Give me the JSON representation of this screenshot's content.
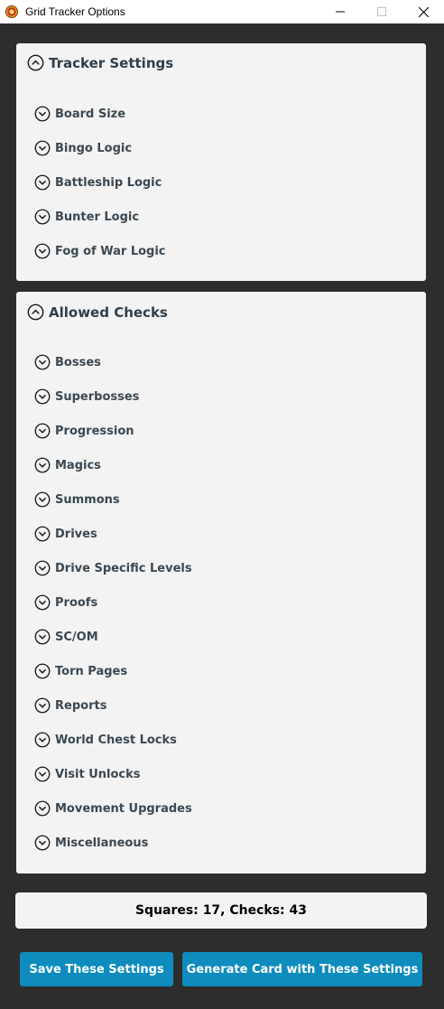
{
  "window": {
    "title": "Grid Tracker Options"
  },
  "tracker_settings": {
    "title": "Tracker Settings",
    "items": [
      {
        "label": "Board Size"
      },
      {
        "label": "Bingo Logic"
      },
      {
        "label": "Battleship Logic"
      },
      {
        "label": "Bunter Logic"
      },
      {
        "label": "Fog of War Logic"
      }
    ]
  },
  "allowed_checks": {
    "title": "Allowed Checks",
    "items": [
      {
        "label": "Bosses"
      },
      {
        "label": "Superbosses"
      },
      {
        "label": "Progression"
      },
      {
        "label": "Magics"
      },
      {
        "label": "Summons"
      },
      {
        "label": "Drives"
      },
      {
        "label": "Drive Specific Levels"
      },
      {
        "label": "Proofs"
      },
      {
        "label": "SC/OM"
      },
      {
        "label": "Torn Pages"
      },
      {
        "label": "Reports"
      },
      {
        "label": "World Chest Locks"
      },
      {
        "label": "Visit Unlocks"
      },
      {
        "label": "Movement Upgrades"
      },
      {
        "label": "Miscellaneous"
      }
    ]
  },
  "summary": {
    "text": "Squares: 17, Checks: 43"
  },
  "buttons": {
    "save": "Save These Settings",
    "generate": "Generate Card with These Settings"
  },
  "colors": {
    "background": "#2d2d2d",
    "panel": "#f3f3f3",
    "button": "#0e8cbd",
    "text": "#3b4852"
  },
  "icons": {
    "expanded": "chevron-up-icon",
    "collapsed": "chevron-down-icon"
  }
}
